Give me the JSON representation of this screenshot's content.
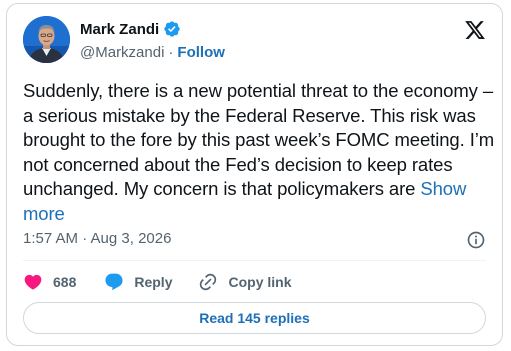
{
  "author": {
    "name": "Mark Zandi",
    "handle": "@Markzandi",
    "separator": "·",
    "follow_label": "Follow",
    "verified": true,
    "avatar_icon": "profile-photo"
  },
  "platform_icon": "x-logo-icon",
  "tweet": {
    "text": "Suddenly, there is a new potential threat to the economy – a serious mistake by the Federal Reserve. This risk was brought to the fore by this past week’s FOMC meeting. I’m not concerned about the Fed’s decision to keep rates unchanged. My concern is that policymakers are",
    "show_more_label": "Show more"
  },
  "meta": {
    "timestamp": "1:57 AM · Aug 3, 2026",
    "info_icon": "info-icon"
  },
  "actions": {
    "like_count": "688",
    "reply_label": "Reply",
    "copy_link_label": "Copy link"
  },
  "read_replies_label": "Read 145 replies",
  "colors": {
    "accent": "#1d70b8",
    "verified": "#1d9bf0",
    "like": "#f91880",
    "muted": "#536471",
    "text": "#0f1419",
    "border": "#cfd9de"
  }
}
